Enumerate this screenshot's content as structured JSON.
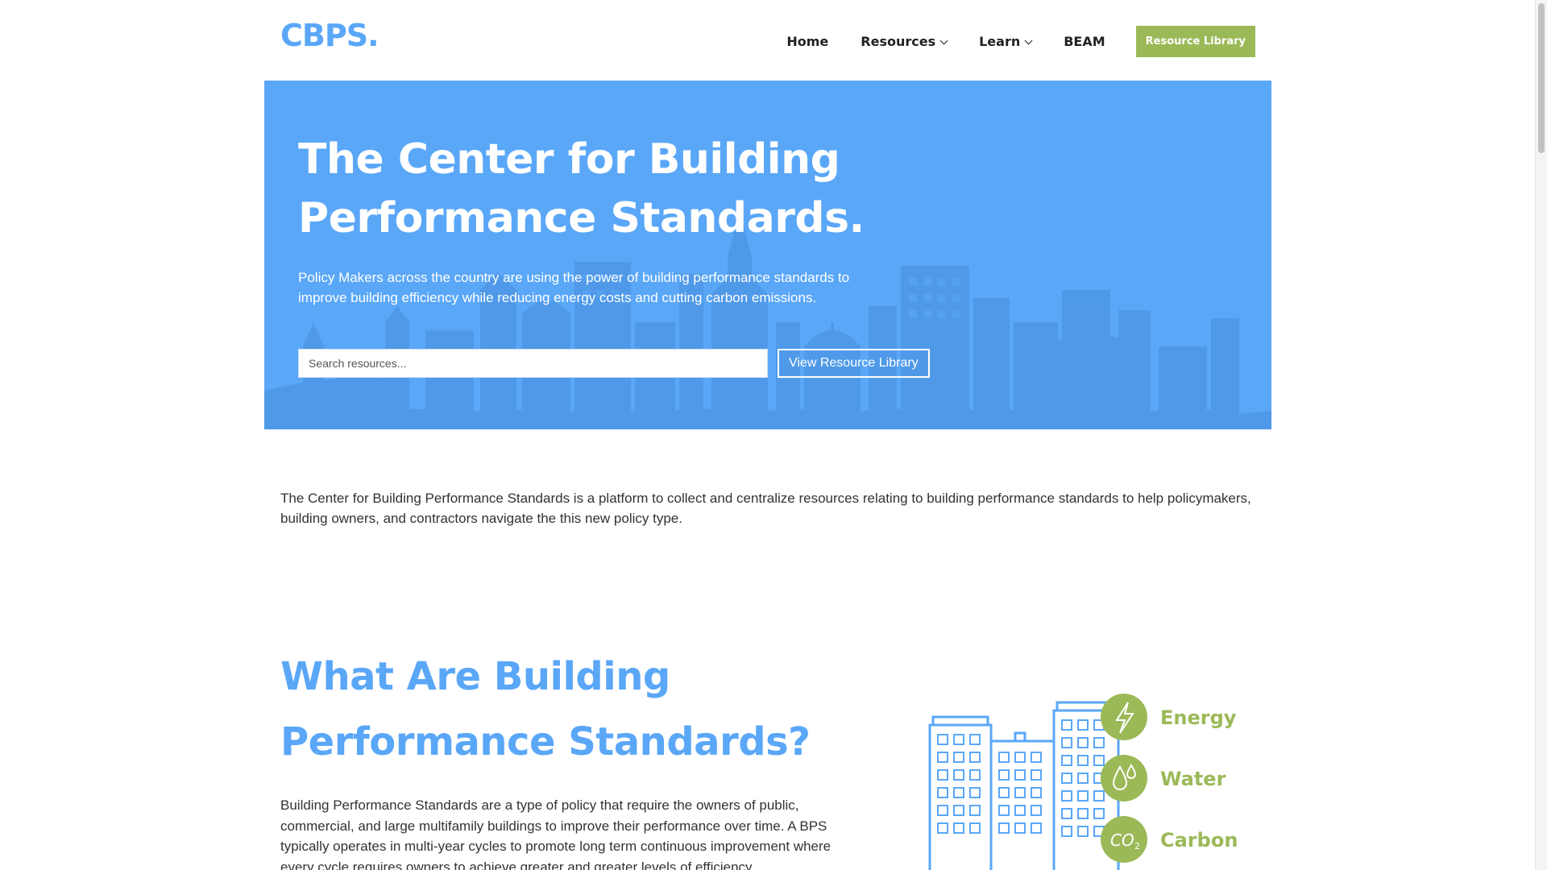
{
  "header": {
    "logo": "CBPS.",
    "nav": {
      "home": "Home",
      "resources": "Resources",
      "learn": "Learn",
      "beam": "BEAM",
      "cta": "Resource Library"
    }
  },
  "hero": {
    "title": "The Center for Building Performance Standards.",
    "subtitle": "Policy Makers across the country are using the power of building performance standards to improve building efficiency while reducing energy costs and cutting carbon emissions.",
    "search_placeholder": "Search resources...",
    "button": "View Resource Library"
  },
  "intro": {
    "text": "The Center for Building Performance Standards is a platform to collect and centralize resources relating to building performance standards to help policymakers, building owners, and contractors navigate the this new policy type."
  },
  "what": {
    "title": "What Are Building Performance Standards?",
    "body": "Building Performance Standards are a type of policy that require the owners of public, commercial, and large multifamily buildings to improve their performance over time. A BPS typically operates in multi-year cycles to promote long term continuous improvement where every cycle requires owners to achieve greater and greater levels of efficiency."
  },
  "infographic": {
    "items": [
      {
        "label": "Energy",
        "icon": "lightning-icon"
      },
      {
        "label": "Water",
        "icon": "water-drop-icon"
      },
      {
        "label": "Carbon",
        "icon": "co2-icon",
        "glyph": "CO",
        "subscript": "2"
      }
    ]
  },
  "colors": {
    "brand_blue": "#5aa7f8",
    "accent_green": "#9bb957",
    "skyline_shade": "#4e97e6"
  }
}
